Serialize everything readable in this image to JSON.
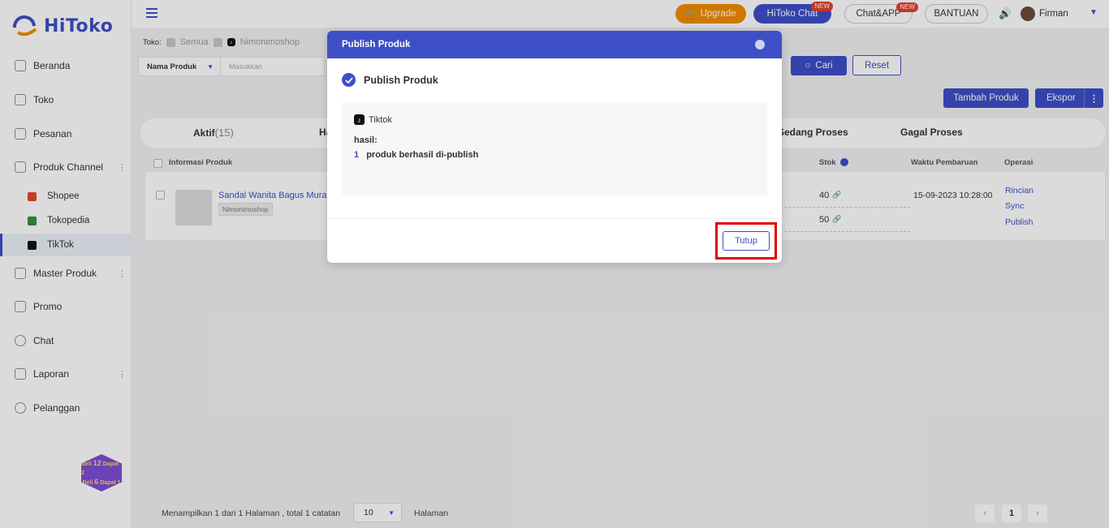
{
  "app": {
    "name": "HiToko"
  },
  "sidebar": {
    "items": [
      {
        "label": "Beranda",
        "icon": "monitor-icon"
      },
      {
        "label": "Toko",
        "icon": "store-icon"
      },
      {
        "label": "Pesanan",
        "icon": "orders-icon"
      },
      {
        "label": "Produk Channel",
        "icon": "grid-icon"
      },
      {
        "label": "Master Produk",
        "icon": "box-icon"
      },
      {
        "label": "Promo",
        "icon": "promo-icon"
      },
      {
        "label": "Chat",
        "icon": "chat-icon"
      },
      {
        "label": "Laporan",
        "icon": "report-icon"
      },
      {
        "label": "Pelanggan",
        "icon": "customers-icon"
      }
    ],
    "channels": [
      {
        "label": "Shopee",
        "color": "#e5482a"
      },
      {
        "label": "Tokopedia",
        "color": "#3a8f3a"
      },
      {
        "label": "TikTok",
        "color": "#111111"
      }
    ],
    "promo": {
      "line1a": "Beli",
      "line1b": "12",
      "line1c": "Dapat",
      "line1d": "2",
      "line2a": "Beli",
      "line2b": "6",
      "line2c": "Dapat",
      "line2d": "1"
    }
  },
  "topbar": {
    "upgrade": "Upgrade",
    "hitoko_chat": "HiToko Chat",
    "chat_app": "Chat&APP",
    "new_tag": "NEW",
    "bantuan": "BANTUAN",
    "user": "Firman"
  },
  "filter": {
    "toko_label": "Toko:",
    "semua": "Semua",
    "shop": "Nimonimoshop",
    "field_select": "Nama Produk",
    "search_placeholder": "Masukkan",
    "cari": "Cari",
    "reset": "Reset",
    "tambah": "Tambah Produk",
    "ekspor": "Ekspor"
  },
  "tabs": [
    {
      "label": "Aktif",
      "count": "(15)"
    },
    {
      "label": "Ha"
    },
    {
      "label": "Sedang Proses"
    },
    {
      "label": "Gagal Proses"
    }
  ],
  "table": {
    "headers": {
      "info": "Informasi Produk",
      "stok": "Stok",
      "waktu": "Waktu Pembaruan",
      "operasi": "Operasi"
    },
    "row": {
      "name": "Sandal Wanita Bagus Murah",
      "shop": "Nimonimoshop",
      "stok": [
        "40",
        "50"
      ],
      "waktu": "15-09-2023 10:28:00",
      "ops": [
        "Rincian",
        "Sync",
        "Publish"
      ]
    }
  },
  "footer": {
    "summary": "Menampilkan 1 dari 1 Halaman , total 1 catatan",
    "page_size": "10",
    "halaman": "Halaman",
    "prev": "‹",
    "current": "1",
    "next": "›"
  },
  "modal": {
    "header": "Publish Produk",
    "title": "Publish Produk",
    "platform": "Tiktok",
    "hasil": "hasil:",
    "count": "1",
    "result": "produk berhasil di-publish",
    "tutup": "Tutup"
  }
}
